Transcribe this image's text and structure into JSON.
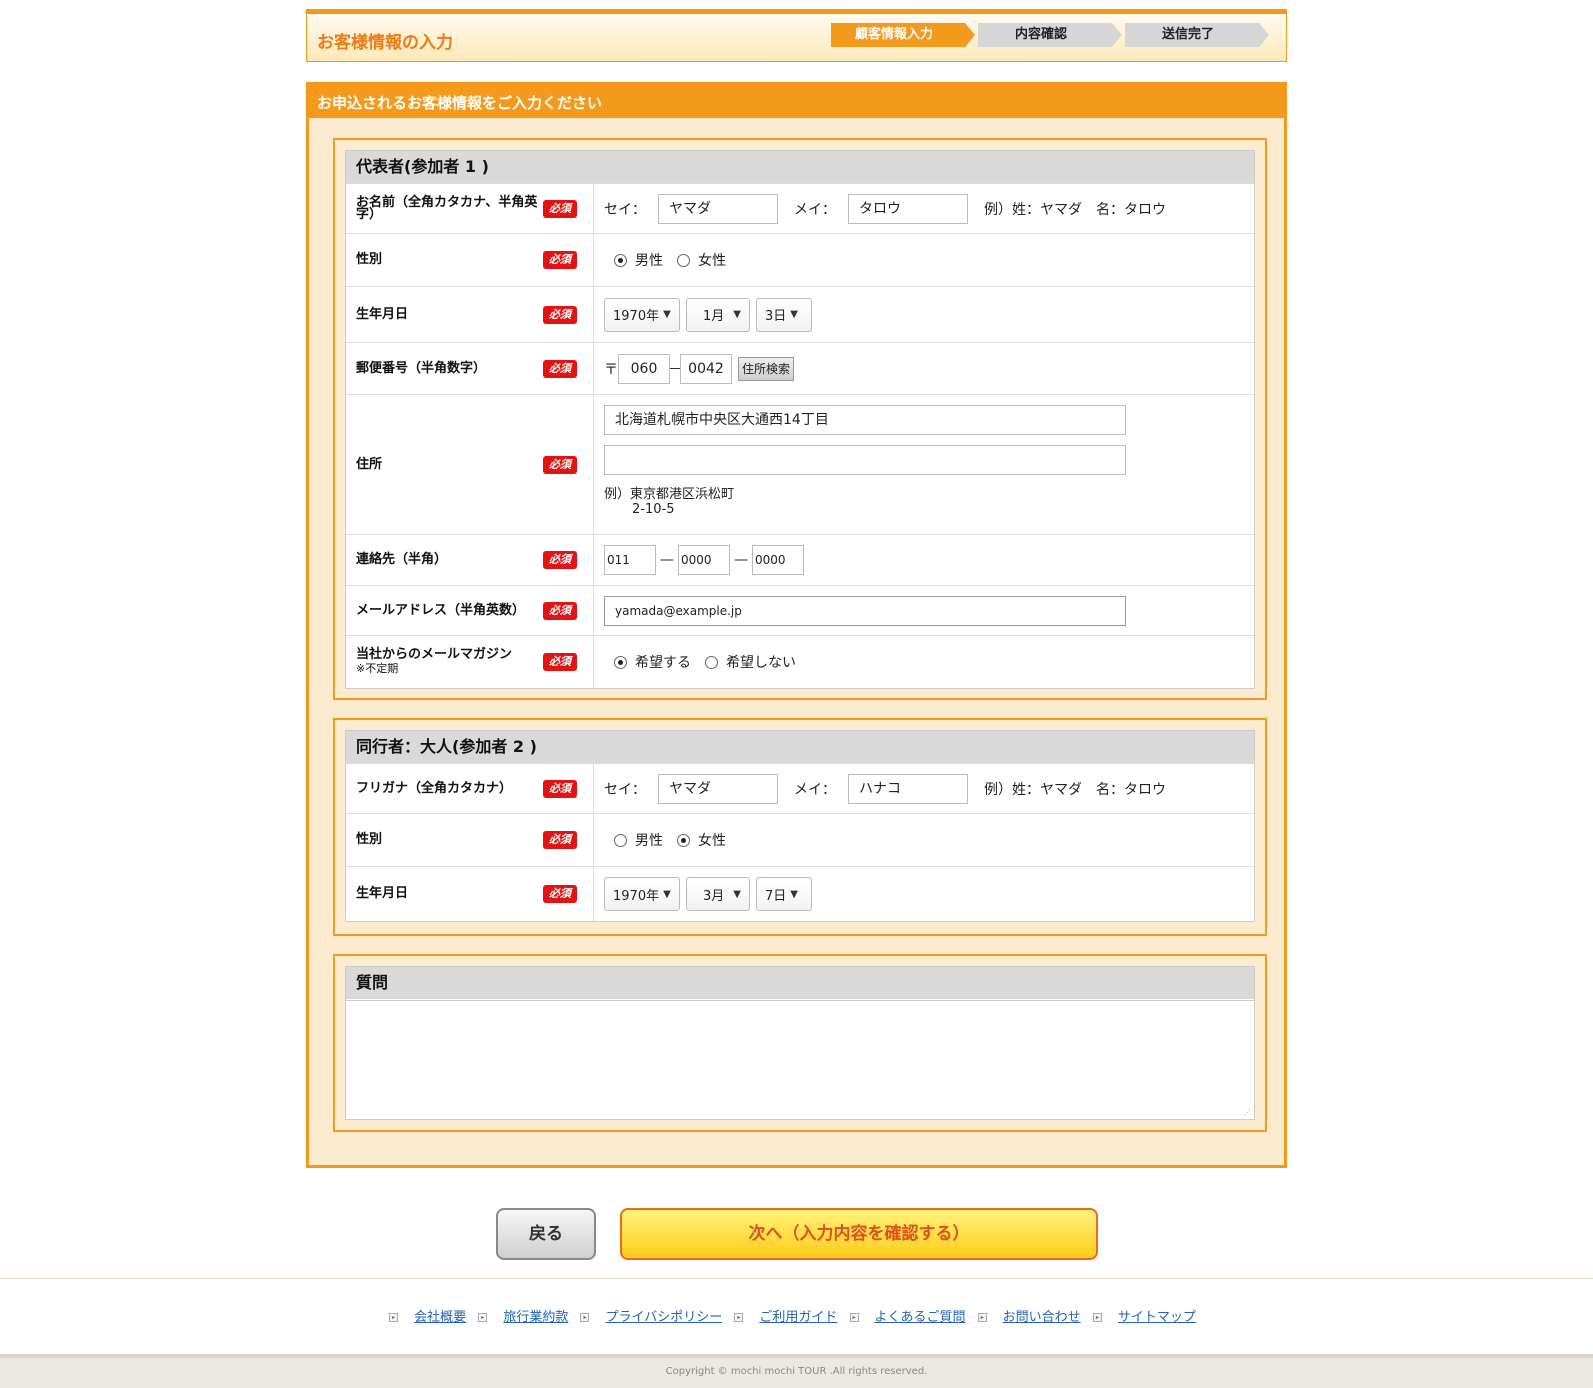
{
  "header": {
    "title": "お客様情報の入力",
    "steps": [
      "顧客情報入力",
      "内容確認",
      "送信完了"
    ]
  },
  "panel": {
    "title": "お申込されるお客様情報をご入力ください"
  },
  "required_label": "必須",
  "rep": {
    "title": "代表者(参加者 1 )",
    "name_label": "お名前（全角カタカナ、半角英字）",
    "sei_label": "セイ：",
    "sei_value": "ヤマダ",
    "mei_label": "メイ：",
    "mei_value": "タロウ",
    "name_example": "例）姓：ヤマダ　名：タロウ",
    "gender_label": "性別",
    "gender_options": [
      "男性",
      "女性"
    ],
    "gender_selected": "男性",
    "birth_label": "生年月日",
    "birth_year": "1970年",
    "birth_month": "1月",
    "birth_day": "3日",
    "zip_label": "郵便番号（半角数字）",
    "zip_mark": "〒",
    "zip1": "060",
    "zip2": "0042",
    "zip_search": "住所検索",
    "address_label": "住所",
    "address1": "北海道札幌市中央区大通西14丁目",
    "address2": "",
    "address_example1": "例）東京都港区浜松町",
    "address_example2": "2-10-5",
    "tel_label": "連絡先（半角）",
    "tel1": "011",
    "tel2": "0000",
    "tel3": "0000",
    "tel_sep": "—",
    "email_label": "メールアドレス（半角英数）",
    "email_value": "yamada@example.jp",
    "magazine_label": "当社からのメールマガジン",
    "magazine_note": "※不定期",
    "magazine_options": [
      "希望する",
      "希望しない"
    ],
    "magazine_selected": "希望する"
  },
  "companion": {
    "title": "同行者：大人(参加者 2 )",
    "name_label": "フリガナ（全角カタカナ）",
    "sei_label": "セイ：",
    "sei_value": "ヤマダ",
    "mei_label": "メイ：",
    "mei_value": "ハナコ",
    "name_example": "例）姓：ヤマダ　名：タロウ",
    "gender_label": "性別",
    "gender_options": [
      "男性",
      "女性"
    ],
    "gender_selected": "女性",
    "birth_label": "生年月日",
    "birth_year": "1970年",
    "birth_month": "3月",
    "birth_day": "7日"
  },
  "question": {
    "title": "質問",
    "value": ""
  },
  "buttons": {
    "back": "戻る",
    "next": "次へ（入力内容を確認する）"
  },
  "footer": {
    "links": [
      "会社概要",
      "旅行業約款",
      "プライバシポリシー",
      "ご利用ガイド",
      "よくあるご質問",
      "お問い合わせ",
      "サイトマップ"
    ],
    "copyright": "Copyright © mochi mochi TOUR .All rights reserved."
  },
  "colors": {
    "accent": "#f39a1d",
    "panel_bg": "#fdebd0",
    "required": "#e41313",
    "link": "#2262b8"
  }
}
